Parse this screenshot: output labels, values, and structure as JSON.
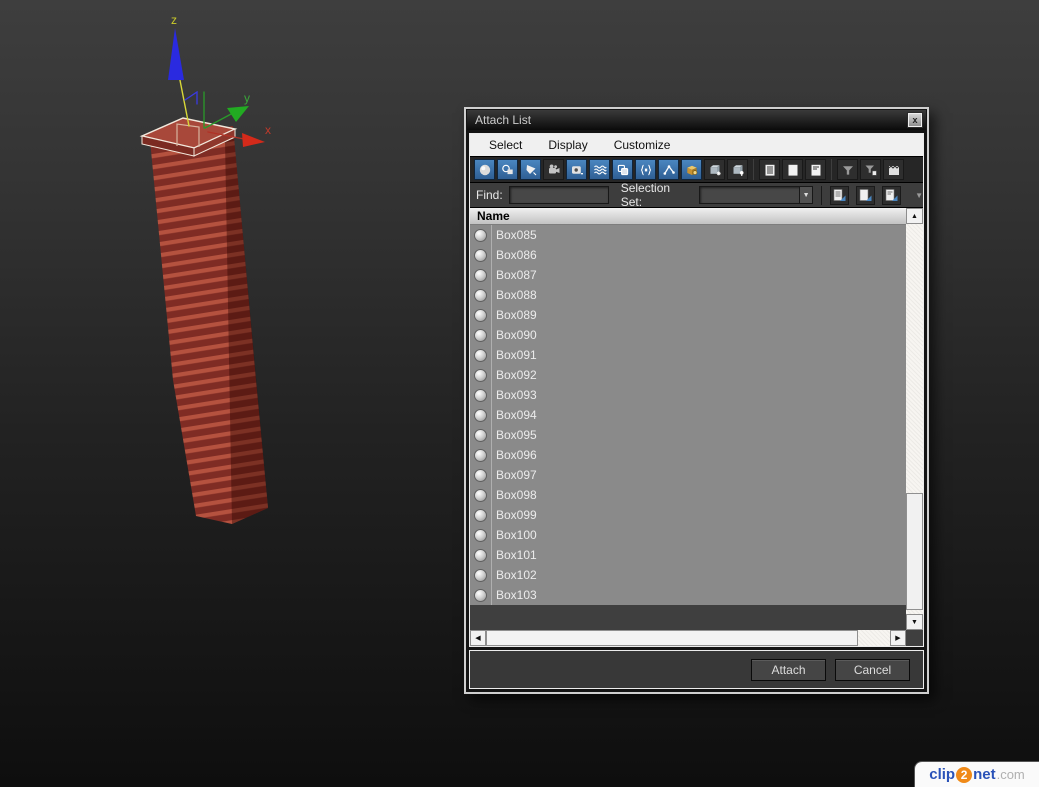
{
  "window": {
    "title": "Attach List",
    "close_glyph": "x"
  },
  "menu": {
    "items": [
      "Select",
      "Display",
      "Customize"
    ]
  },
  "toolbar": {
    "icons": [
      "display-geometry",
      "display-shapes",
      "display-lights",
      "display-cameras",
      "display-helpers",
      "display-space-warps",
      "display-groups",
      "display-xrefs",
      "display-bones",
      "display-containers",
      "display-frozen",
      "display-hidden",
      "list-view",
      "blank-view",
      "detail-view",
      "filter",
      "filter-combinations",
      "advanced-filter"
    ]
  },
  "findbar": {
    "find_label": "Find:",
    "find_value": "",
    "selection_set_label": "Selection Set:",
    "selection_set_value": "",
    "combo_arrow": "▼",
    "icons": [
      "save-selection-set",
      "create-selection-set",
      "duplicate-selection-set"
    ],
    "more_glyph": "▼"
  },
  "list": {
    "header": "Name",
    "items": [
      "Box085",
      "Box086",
      "Box087",
      "Box088",
      "Box089",
      "Box090",
      "Box091",
      "Box092",
      "Box093",
      "Box094",
      "Box095",
      "Box096",
      "Box097",
      "Box098",
      "Box099",
      "Box100",
      "Box101",
      "Box102",
      "Box103"
    ]
  },
  "scrollbars": {
    "up": "▲",
    "down": "▼",
    "left": "◀",
    "right": "▶"
  },
  "footer": {
    "attach_label": "Attach",
    "cancel_label": "Cancel"
  },
  "viewport": {
    "axis_x": "x",
    "axis_y": "y",
    "axis_z": "z"
  },
  "watermark": {
    "part1": "clip",
    "part2": "2",
    "part3": "net",
    "part4": ".com"
  },
  "colors": {
    "accent_blue": "#3a74ae",
    "list_bg": "#8a8a8a",
    "tower_light": "#b5523f",
    "tower_dark": "#7f2c24",
    "axis_x": "#c03a2a",
    "axis_y": "#3aa63a",
    "axis_z": "#cbcb2a"
  }
}
